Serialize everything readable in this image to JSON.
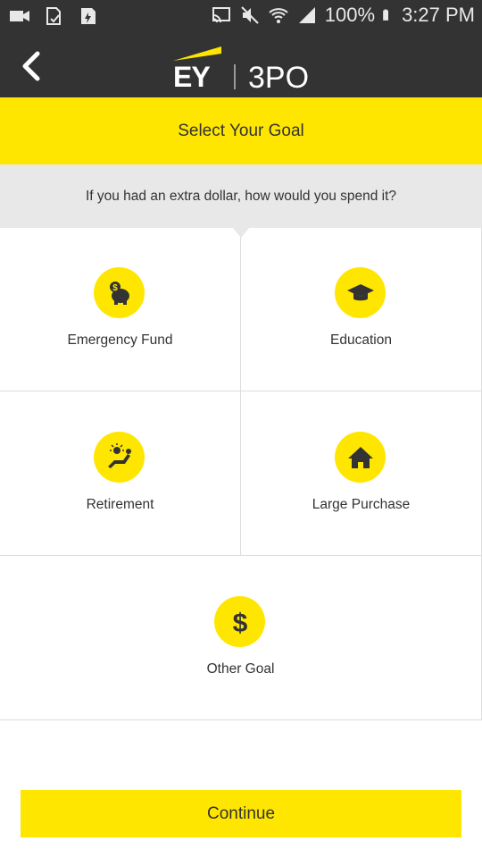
{
  "status_bar": {
    "battery": "100%",
    "time": "3:27 PM",
    "left_icons": [
      "video-camera-icon",
      "sd-card-check-icon",
      "sd-card-charging-icon"
    ],
    "right_icons": [
      "cast-icon",
      "mute-icon",
      "wifi-icon",
      "signal-icon",
      "battery-icon"
    ]
  },
  "app_bar": {
    "logo_brand": "EY",
    "logo_product": "3PO",
    "back_icon": "chevron-left-icon"
  },
  "header": {
    "title": "Select Your Goal"
  },
  "question": {
    "text": "If you had an extra dollar, how would you spend it?"
  },
  "goals": [
    {
      "label": "Emergency Fund",
      "icon": "piggy-bank-icon"
    },
    {
      "label": "Education",
      "icon": "graduation-cap-icon"
    },
    {
      "label": "Retirement",
      "icon": "lounge-chair-sun-icon"
    },
    {
      "label": "Large Purchase",
      "icon": "house-icon"
    },
    {
      "label": "Other Goal",
      "icon": "dollar-sign-icon"
    }
  ],
  "footer": {
    "continue_label": "Continue"
  },
  "colors": {
    "accent": "#ffe600",
    "bar": "#333333",
    "question_bg": "#e8e8e8",
    "text": "#333333"
  }
}
